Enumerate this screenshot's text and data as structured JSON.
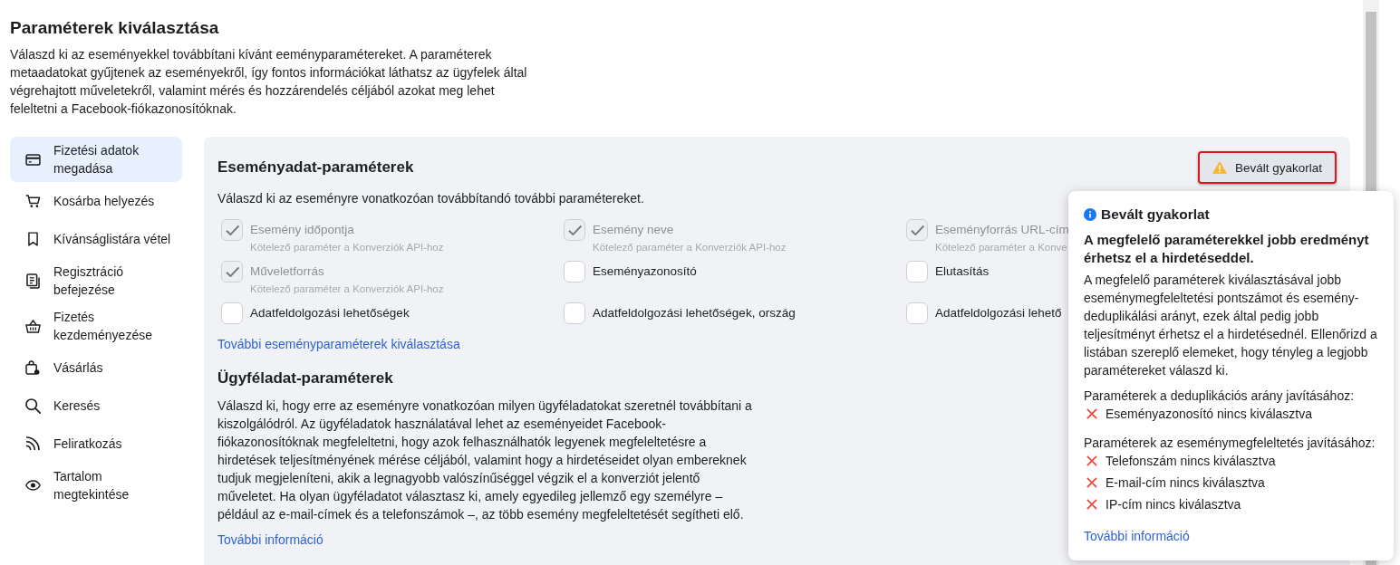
{
  "header": {
    "title": "Paraméterek kiválasztása",
    "description": "Válaszd ki az eseményekkel továbbítani kívánt eeményparamétereket. A paraméterek metaadatokat gyűjtenek az eseményekről, így fontos információkat láthatsz az ügyfelek által végrehajtott műveletekről, valamint mérés és hozzárendelés céljából azokat meg lehet feleltetni a Facebook-fiókazonosítóknak."
  },
  "sidebar": {
    "items": [
      {
        "label": "Fizetési adatok megadása",
        "selected": true
      },
      {
        "label": "Kosárba helyezés",
        "selected": false
      },
      {
        "label": "Kívánságlistára vétel",
        "selected": false
      },
      {
        "label": "Regisztráció befejezése",
        "selected": false
      },
      {
        "label": "Fizetés kezdeményezése",
        "selected": false
      },
      {
        "label": "Vásárlás",
        "selected": false
      },
      {
        "label": "Keresés",
        "selected": false
      },
      {
        "label": "Feliratkozás",
        "selected": false
      },
      {
        "label": "Tartalom megtekintése",
        "selected": false
      }
    ]
  },
  "event_params": {
    "title": "Eseményadat-paraméterek",
    "best_practice_button": {
      "label": "Bevált gyakorlat",
      "highlighted": true
    },
    "description": "Válaszd ki az eseményre vonatkozóan továbbítandó további paramétereket.",
    "options": [
      {
        "label": "Esemény időpontja",
        "note": "Kötelező paraméter a Konverziók API-hoz",
        "checked": true,
        "disabled": true
      },
      {
        "label": "Esemény neve",
        "note": "Kötelező paraméter a Konverziók API-hoz",
        "checked": true,
        "disabled": true
      },
      {
        "label": "Eseményforrás URL-cím",
        "note": "Kötelező paraméter a Konve",
        "checked": true,
        "disabled": true
      },
      {
        "label": "Műveletforrás",
        "note": "Kötelező paraméter a Konverziók API-hoz",
        "checked": true,
        "disabled": true
      },
      {
        "label": "Eseményazonosító",
        "checked": false,
        "disabled": false
      },
      {
        "label": "Elutasítás",
        "checked": false,
        "disabled": false
      },
      {
        "label": "Adatfeldolgozási lehetőségek",
        "checked": false,
        "disabled": false
      },
      {
        "label": "Adatfeldolgozási lehetőségek, ország",
        "checked": false,
        "disabled": false
      },
      {
        "label": "Adatfeldolgozási lehető",
        "checked": false,
        "disabled": false
      }
    ],
    "link": "További eseményparaméterek kiválasztása"
  },
  "customer_params": {
    "title": "Ügyféladat-paraméterek",
    "description": "Válaszd ki, hogy erre az eseményre vonatkozóan milyen ügyféladatokat szeretnél továbbítani a kiszolgálódról. Az ügyféladatok használatával lehet az eseményeidet Facebook-fiókazonosítóknak megfeleltetni, hogy azok felhasználhatók legyenek megfeleltetésre a hirdetések teljesítményének mérése céljából, valamint hogy a hirdetéseidet olyan embereknek tudjuk megjeleníteni, akik a legnagyobb valószínűséggel végzik el a konverziót jelentő műveletet. Ha olyan ügyféladatot választasz ki, amely egyedileg jellemző egy személyre – például az e-mail-címek és a telefonszámok –, az több esemény megfeleltetését segítheti elő.",
    "link": "További információ"
  },
  "popover": {
    "title": "Bevált gyakorlat",
    "headline": "A megfelelő paraméterekkel jobb eredményt érhetsz el a hirdetéseddel.",
    "body": "A megfelelő paraméterek kiválasztásával jobb eseménymegfeleltetési pontszámot és esemény-deduplikálási arányt, ezek által pedig jobb teljesítményt érhetsz el a hirdetésednél. Ellenőrizd a listában szereplő elemeket, hogy tényleg a legjobb paramétereket válaszd ki.",
    "groups": [
      {
        "heading": "Paraméterek a deduplikációs arány javításához:",
        "issues": [
          "Eseményazonosító nincs kiválasztva"
        ]
      },
      {
        "heading": "Paraméterek az eseménymegfeleltetés javításához:",
        "issues": [
          "Telefonszám nincs kiválasztva",
          "E-mail-cím nincs kiválasztva",
          "IP-cím nincs kiválasztva"
        ]
      }
    ],
    "link": "További információ"
  }
}
